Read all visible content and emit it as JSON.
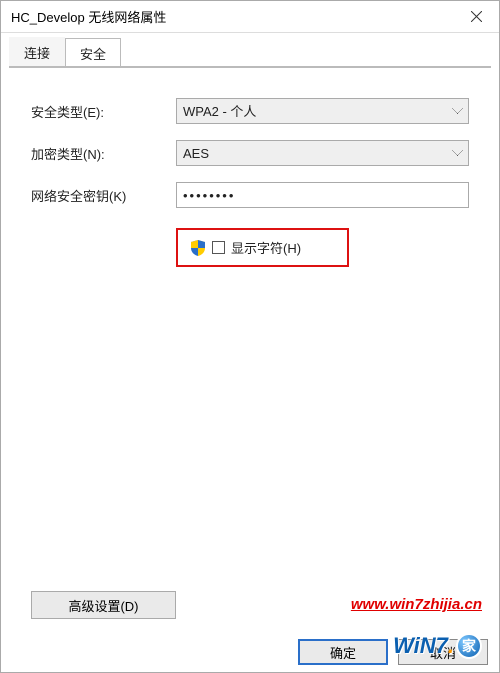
{
  "window": {
    "title": "HC_Develop 无线网络属性"
  },
  "tabs": {
    "connect": "连接",
    "security": "安全"
  },
  "form": {
    "securityTypeLabel": "安全类型(E):",
    "securityTypeValue": "WPA2 - 个人",
    "encryptionTypeLabel": "加密类型(N):",
    "encryptionTypeValue": "AES",
    "keyLabel": "网络安全密钥(K)",
    "keyValue": "●●●●●●●●",
    "showCharsLabel": "显示字符(H)"
  },
  "buttons": {
    "advanced": "高级设置(D)",
    "ok": "确定",
    "cancel": "取消"
  },
  "watermark": "www.win7zhijia.cn",
  "logo": {
    "text1": "WiN7",
    "text2": "家"
  }
}
